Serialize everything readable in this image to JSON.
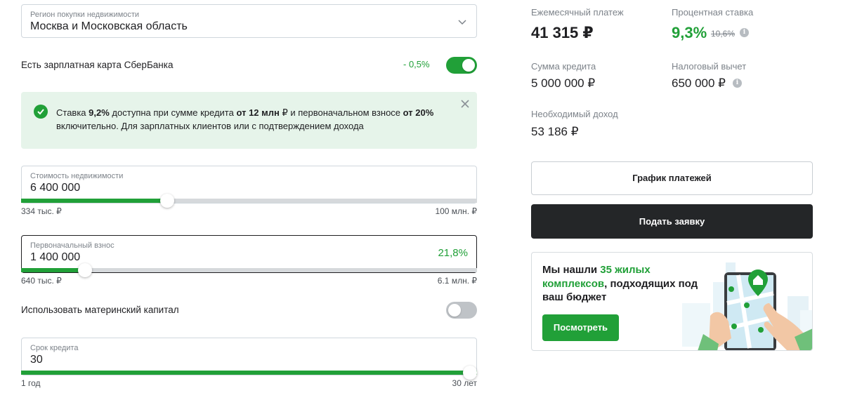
{
  "region": {
    "label": "Регион покупки недвижимости",
    "value": "Москва и Московская область"
  },
  "salary_card": {
    "label": "Есть зарплатная карта СберБанка",
    "discount": "- 0,5%",
    "enabled": true
  },
  "notice": {
    "t1": "Ставка ",
    "rate": "9,2%",
    "t2": " доступна при сумме кредита ",
    "amount": "от 12 млн",
    "t3": " ₽ и первоначальном взносе ",
    "down": "от 20%",
    "t4": " включительно. Для зарплатных клиентов или с подтверждением дохода"
  },
  "property_cost": {
    "label": "Стоимость недвижимости",
    "value": "6 400 000",
    "min": "334 тыс. ₽",
    "max": "100 млн. ₽",
    "fill_fraction": 0.32
  },
  "down_payment": {
    "label": "Первоначальный взнос",
    "value": "1 400 000",
    "percent": "21,8%",
    "min": "640 тыс. ₽",
    "max": "6.1 млн. ₽",
    "fill_fraction": 0.14
  },
  "maternal_capital": {
    "label": "Использовать материнский капитал",
    "enabled": false
  },
  "term": {
    "label": "Срок кредита",
    "value": "30",
    "min": "1 год",
    "max": "30 лет",
    "fill_fraction": 1.0
  },
  "summary": {
    "monthly_label": "Ежемесячный платеж",
    "monthly_value": "41 315 ₽",
    "rate_label": "Процентная ставка",
    "rate_value": "9,3%",
    "rate_old": "10,6%",
    "loan_label": "Сумма кредита",
    "loan_value": "5 000 000 ₽",
    "tax_label": "Налоговый вычет",
    "tax_value": "650 000 ₽",
    "income_label": "Необходимый доход",
    "income_value": "53 186 ₽"
  },
  "buttons": {
    "schedule": "График платежей",
    "apply": "Подать заявку"
  },
  "promo": {
    "t1": "Мы нашли ",
    "highlight": "35 жилых комплексов",
    "t2": ", подходящих под ваш бюджет",
    "button": "Посмотреть"
  },
  "colors": {
    "accent": "#21a038",
    "dark_button": "#242628",
    "notice_bg": "#e6f4ea"
  }
}
